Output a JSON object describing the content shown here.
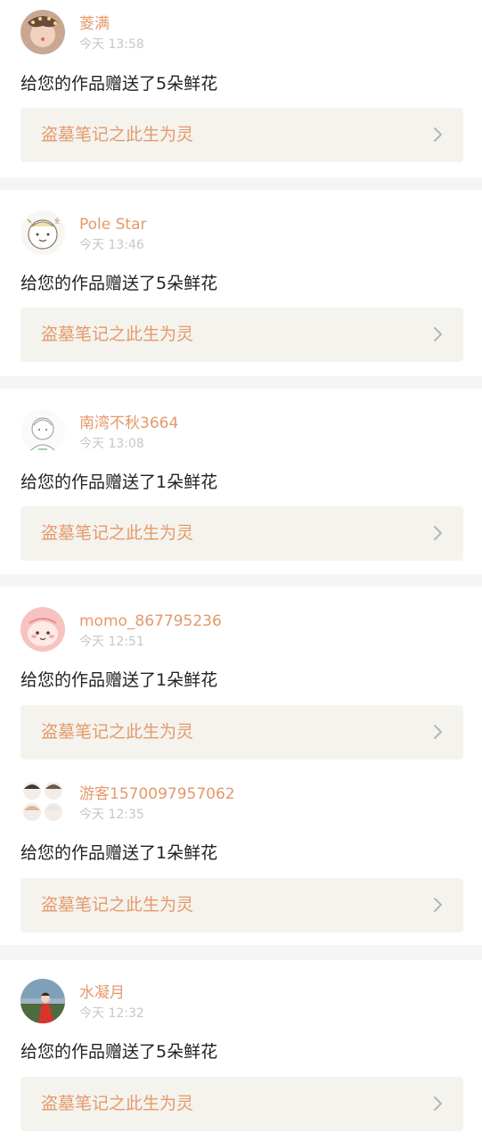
{
  "colors": {
    "accent": "#e4996a",
    "timestamp": "#c7c7c7",
    "message": "#222222",
    "link_bg": "#f4f3ee",
    "separator": "#f5f5f5"
  },
  "notifications": [
    {
      "username": "菱满",
      "time": "今天 13:58",
      "message": "给您的作品赠送了5朵鲜花",
      "work_title": "盗墓笔记之此生为灵",
      "chevron_icon": "chevron-right-icon"
    },
    {
      "username": "Pole Star",
      "time": "今天 13:46",
      "message": "给您的作品赠送了5朵鲜花",
      "work_title": "盗墓笔记之此生为灵",
      "chevron_icon": "chevron-right-icon"
    },
    {
      "username": "南湾不秋3664",
      "time": "今天 13:08",
      "message": "给您的作品赠送了1朵鲜花",
      "work_title": "盗墓笔记之此生为灵",
      "chevron_icon": "chevron-right-icon"
    },
    {
      "username": "momo_867795236",
      "time": "今天 12:51",
      "message": "给您的作品赠送了1朵鲜花",
      "work_title": "盗墓笔记之此生为灵",
      "chevron_icon": "chevron-right-icon"
    },
    {
      "username": "游客1570097957062",
      "time": "今天 12:35",
      "message": "给您的作品赠送了1朵鲜花",
      "work_title": "盗墓笔记之此生为灵",
      "chevron_icon": "chevron-right-icon"
    },
    {
      "username": "水凝月",
      "time": "今天 12:32",
      "message": "给您的作品赠送了5朵鲜花",
      "work_title": "盗墓笔记之此生为灵",
      "chevron_icon": "chevron-right-icon"
    }
  ]
}
